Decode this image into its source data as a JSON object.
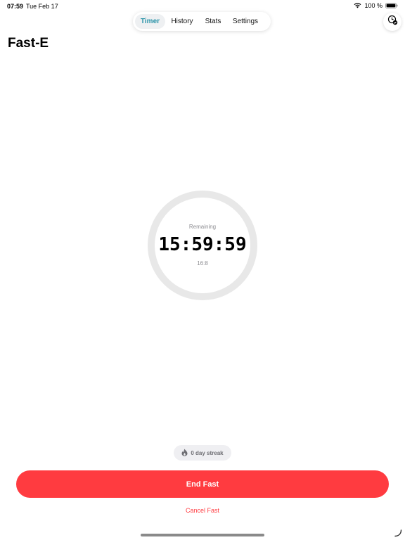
{
  "status_bar": {
    "time": "07:59",
    "date": "Tue Feb 17",
    "battery_percent": "100 %",
    "icons": [
      "wifi-icon",
      "battery-icon"
    ]
  },
  "tabs": [
    {
      "label": "Timer",
      "active": true
    },
    {
      "label": "History",
      "active": false
    },
    {
      "label": "Stats",
      "active": false
    },
    {
      "label": "Settings",
      "active": false
    }
  ],
  "header": {
    "title": "Fast-E",
    "action_icon": "clock-check-icon"
  },
  "timer": {
    "label": "Remaining",
    "time": "15:59:59",
    "plan": "16:8",
    "progress": 0.0
  },
  "streak": {
    "icon": "flame-icon",
    "label": "0 day streak"
  },
  "actions": {
    "end_label": "End Fast",
    "cancel_label": "Cancel Fast"
  },
  "colors": {
    "accent": "#2a93a8",
    "danger": "#ff3b40",
    "ring_track": "#e8e8e8"
  }
}
